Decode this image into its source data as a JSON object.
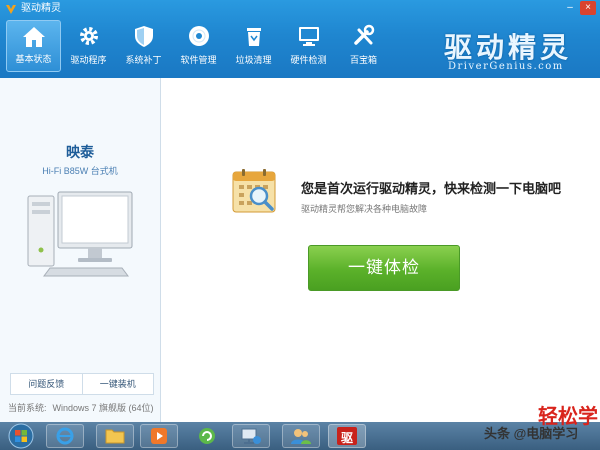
{
  "window": {
    "title": "驱动精灵",
    "minimize": "–",
    "close": "×"
  },
  "nav": [
    {
      "label": "基本状态",
      "icon": "home-icon",
      "active": true
    },
    {
      "label": "驱动程序",
      "icon": "gear-icon"
    },
    {
      "label": "系统补丁",
      "icon": "shield-icon"
    },
    {
      "label": "软件管理",
      "icon": "disc-icon"
    },
    {
      "label": "垃圾清理",
      "icon": "recycle-bin-icon"
    },
    {
      "label": "硬件检测",
      "icon": "monitor-icon"
    },
    {
      "label": "百宝箱",
      "icon": "tools-icon"
    }
  ],
  "logo": {
    "cn": "驱动精灵",
    "en": "DriverGenius.com"
  },
  "device": {
    "brand": "映泰",
    "model": "Hi-Fi B85W 台式机"
  },
  "actions": {
    "feedback": "问题反馈",
    "one_click_install": "一键装机"
  },
  "system": {
    "label": "当前系统:",
    "value": "Windows 7 旗舰版 (64位)"
  },
  "main": {
    "headline": "您是首次运行驱动精灵，快来检测一下电脑吧",
    "sub": "驱动精灵帮您解决各种电脑故障",
    "check_button": "一键体检"
  },
  "taskbar": {
    "items": [
      "start-orb-icon",
      "ie-icon",
      "explorer-icon",
      "media-player-icon",
      "ie-refresh-icon",
      "network-icon",
      "users-icon",
      "driver-genius-icon"
    ],
    "app_glyph": "驱"
  },
  "watermark": {
    "author": "头条 @电脑学习",
    "red": "轻松学"
  }
}
